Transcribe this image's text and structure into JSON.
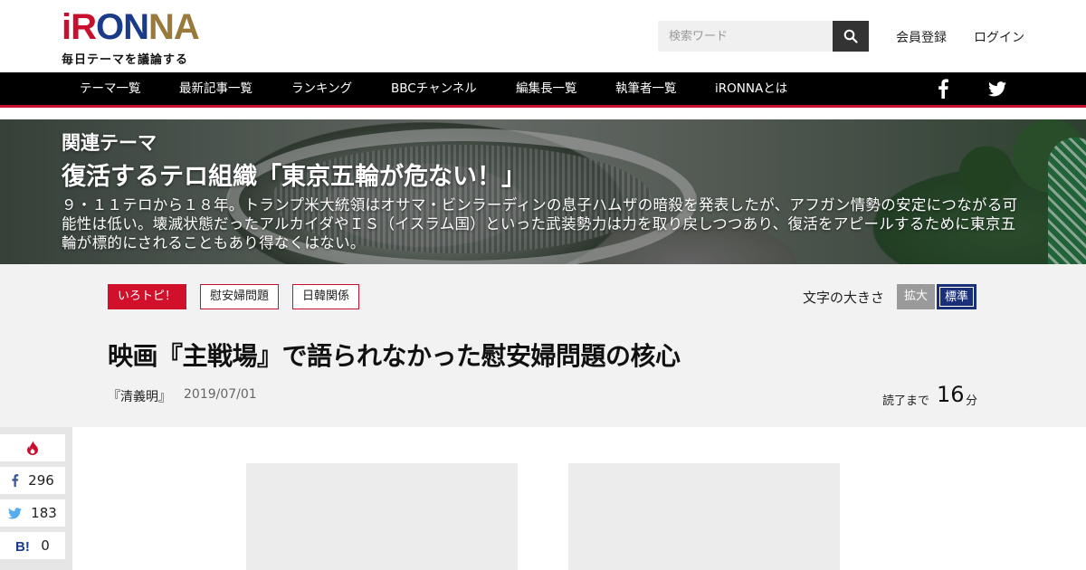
{
  "header": {
    "logo_letters": [
      {
        "char": "i",
        "color": "#c8102e"
      },
      {
        "char": "R",
        "color": "#c8102e"
      },
      {
        "char": "O",
        "color": "#1a3a8a"
      },
      {
        "char": "N",
        "color": "#1a3a8a"
      },
      {
        "char": "N",
        "color": "#9a7a3a"
      },
      {
        "char": "A",
        "color": "#9a7a3a"
      }
    ],
    "tagline": "毎日テーマを議論する",
    "search_placeholder": "検索ワード",
    "register": "会員登録",
    "login": "ログイン"
  },
  "nav": {
    "items": [
      "テーマ一覧",
      "最新記事一覧",
      "ランキング",
      "BBCチャンネル",
      "編集長一覧",
      "執筆者一覧",
      "iRONNAとは"
    ]
  },
  "hero": {
    "kicker": "関連テーマ",
    "title": "復活するテロ組織「東京五輪が危ない！」",
    "description": "９・１１テロから１８年。トランプ米大統領はオサマ・ビンラーディンの息子ハムザの暗殺を発表したが、アフガン情勢の安定につながる可能性は低い。壊滅状態だったアルカイダやＩＳ（イスラム国）といった武装勢力は力を取り戻しつつあり、復活をアピールするために東京五輪が標的にされることもあり得なくはない。"
  },
  "article": {
    "tags": [
      "いろトピ！",
      "慰安婦問題",
      "日韓関係"
    ],
    "font_size_label": "文字の大きさ",
    "font_size_large": "拡大",
    "font_size_standard": "標準",
    "title": "映画『主戦場』で語られなかった慰安婦問題の核心",
    "author": "『清義明』",
    "date": "2019/07/01",
    "read_prefix": "読了まで",
    "read_minutes": "16",
    "read_unit": "分"
  },
  "share": {
    "facebook_count": "296",
    "twitter_count": "183",
    "hatena_count": "0"
  },
  "colors": {
    "accent_red": "#c8102e",
    "nav_bg": "#000000",
    "standard_btn": "#1a2f7a"
  }
}
